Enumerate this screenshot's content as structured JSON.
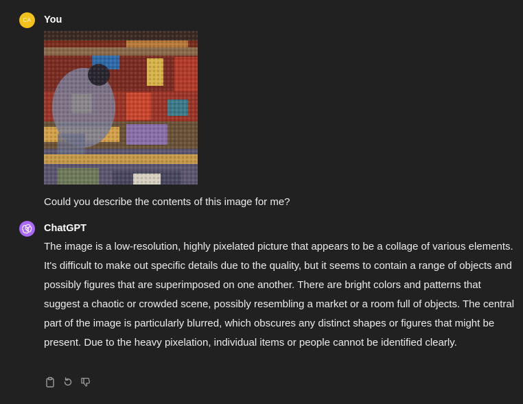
{
  "user": {
    "initials": "CA",
    "name": "You",
    "message": "Could you describe the contents of this image for me?",
    "avatar_color": "#f2c21b"
  },
  "assistant": {
    "name": "ChatGPT",
    "avatar_color": "#ab68ff",
    "message": "The image is a low-resolution, highly pixelated picture that appears to be a collage of various elements. It's difficult to make out specific details due to the quality, but it seems to contain a range of objects and possibly figures that are superimposed on one another. There are bright colors and patterns that suggest a chaotic or crowded scene, possibly resembling a market or a room full of objects. The central part of the image is particularly blurred, which obscures any distinct shapes or figures that might be present. Due to the heavy pixelation, individual items or people cannot be identified clearly."
  },
  "actions": [
    {
      "icon": "clipboard-icon"
    },
    {
      "icon": "regenerate-icon"
    },
    {
      "icon": "thumbs-down-icon"
    }
  ],
  "colors": {
    "background": "#212121",
    "text": "#ececec",
    "muted_icon": "#9b9b9b"
  }
}
